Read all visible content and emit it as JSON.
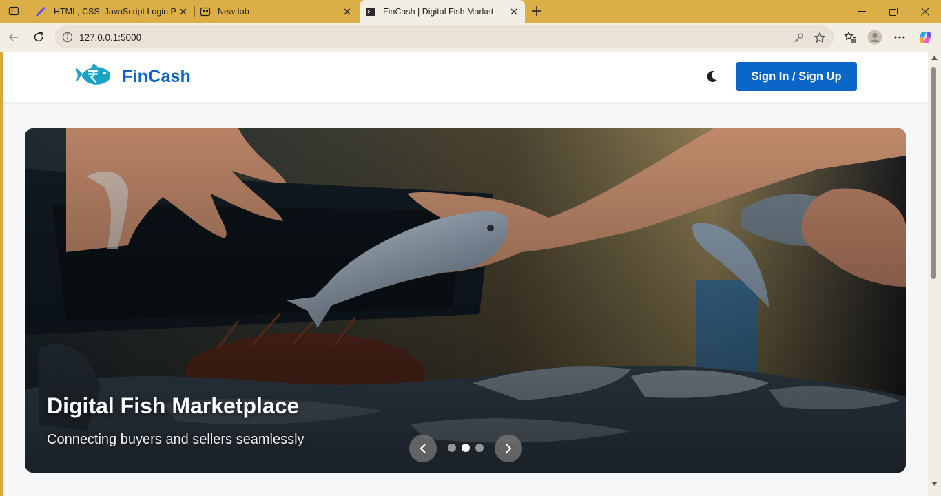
{
  "browser": {
    "tabs": [
      {
        "title": "HTML, CSS, JavaScript Login Page",
        "icon": "wand-favicon-icon",
        "active": false
      },
      {
        "title": "New tab",
        "icon": "newtab-favicon-icon",
        "active": false
      },
      {
        "title": "FinCash | Digital Fish Market",
        "icon": "terminal-favicon-icon",
        "active": true
      }
    ],
    "url": "127.0.0.1:5000"
  },
  "site": {
    "brand": "FinCash",
    "signin_label": "Sign In / Sign Up",
    "theme_icon": "moon-icon",
    "accent_color": "#0a66c8"
  },
  "hero": {
    "title": "Digital Fish Marketplace",
    "subtitle": "Connecting buyers and sellers seamlessly",
    "slide_count": 3,
    "active_slide": 2
  }
}
